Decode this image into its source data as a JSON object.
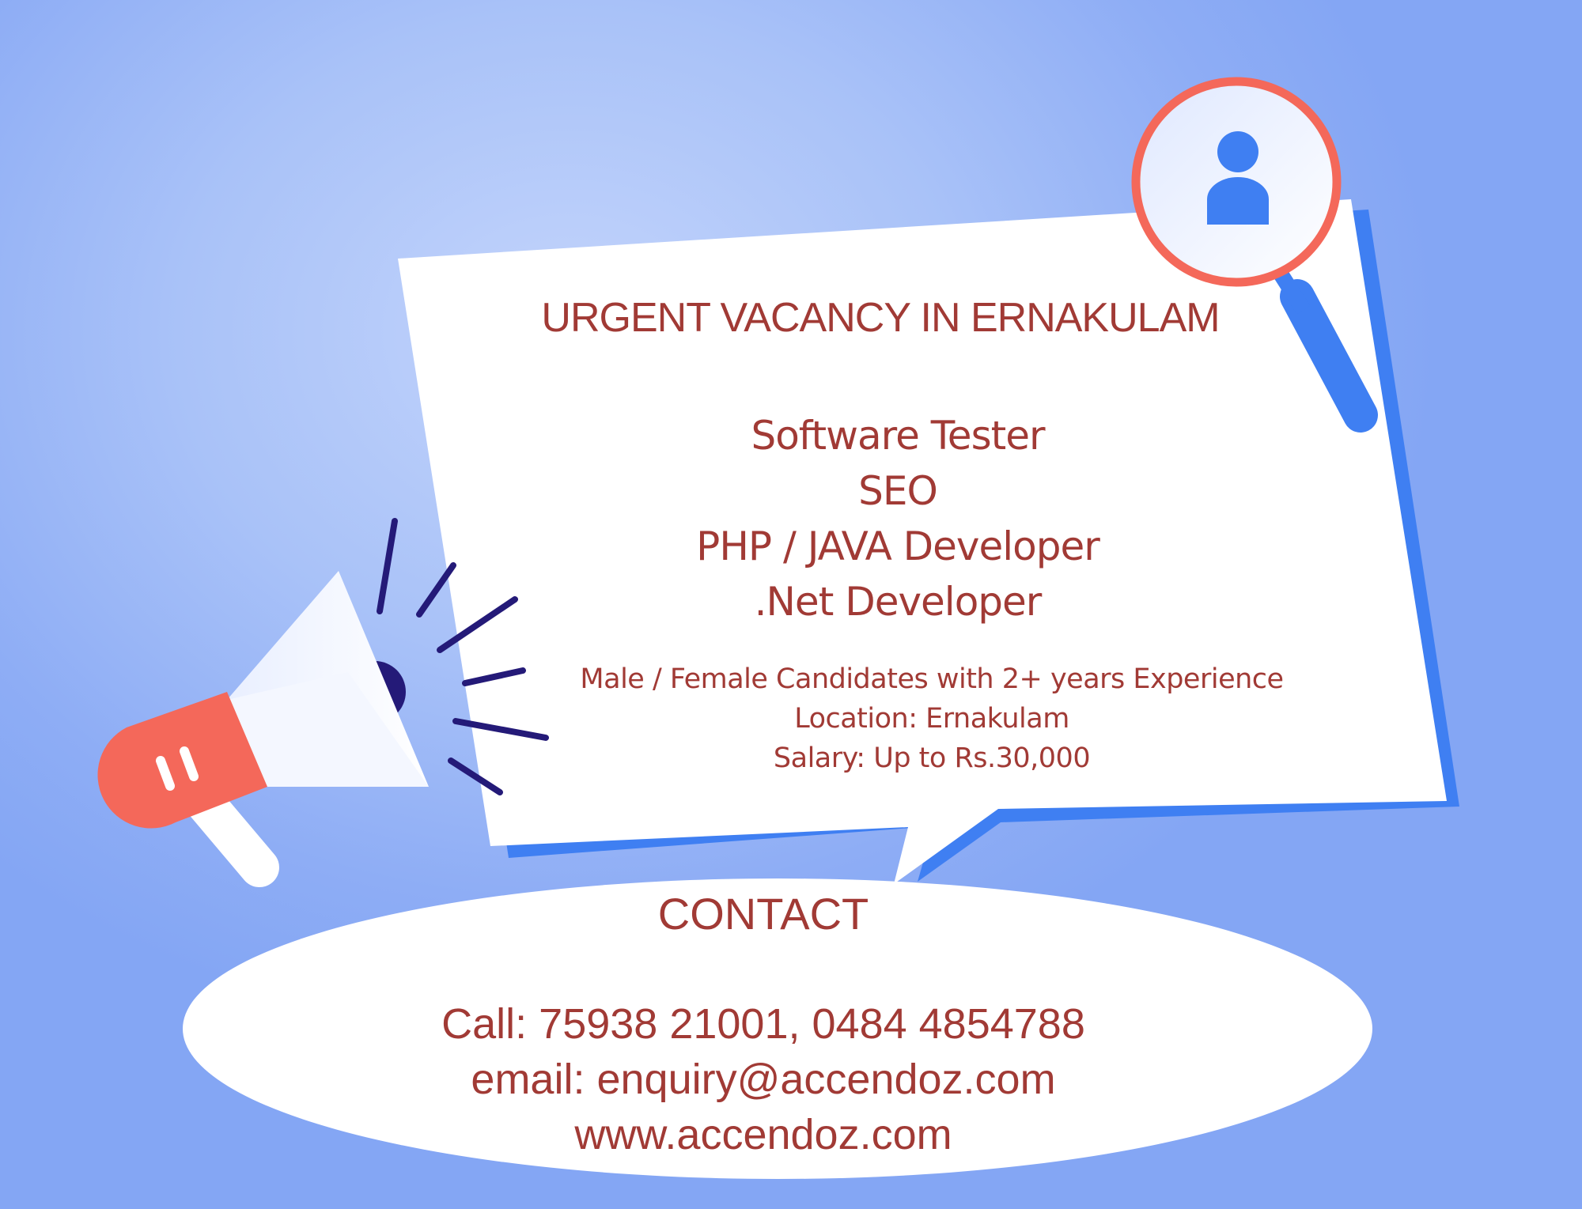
{
  "poster": {
    "headline": "URGENT VACANCY IN ERNAKULAM",
    "roles": [
      "Software Tester",
      "SEO",
      "PHP / JAVA Developer",
      ".Net Developer"
    ],
    "details": [
      "Male / Female Candidates with 2+ years Experience",
      "Location: Ernakulam",
      "Salary: Up to Rs.30,000"
    ],
    "contact": {
      "heading": "CONTACT",
      "lines": [
        "Call: 75938 21001, 0484 4854788",
        "email: enquiry@accendoz.com",
        "www.accendoz.com"
      ]
    }
  },
  "icons": [
    "megaphone-icon",
    "magnifier-icon",
    "person-icon"
  ],
  "colors": {
    "background": "#9fb9f7",
    "text": "#a13a35",
    "accent_blue": "#3f7ff2",
    "accent_red": "#f4685a",
    "megaphone_lines": "#241a78",
    "card": "#ffffff"
  }
}
